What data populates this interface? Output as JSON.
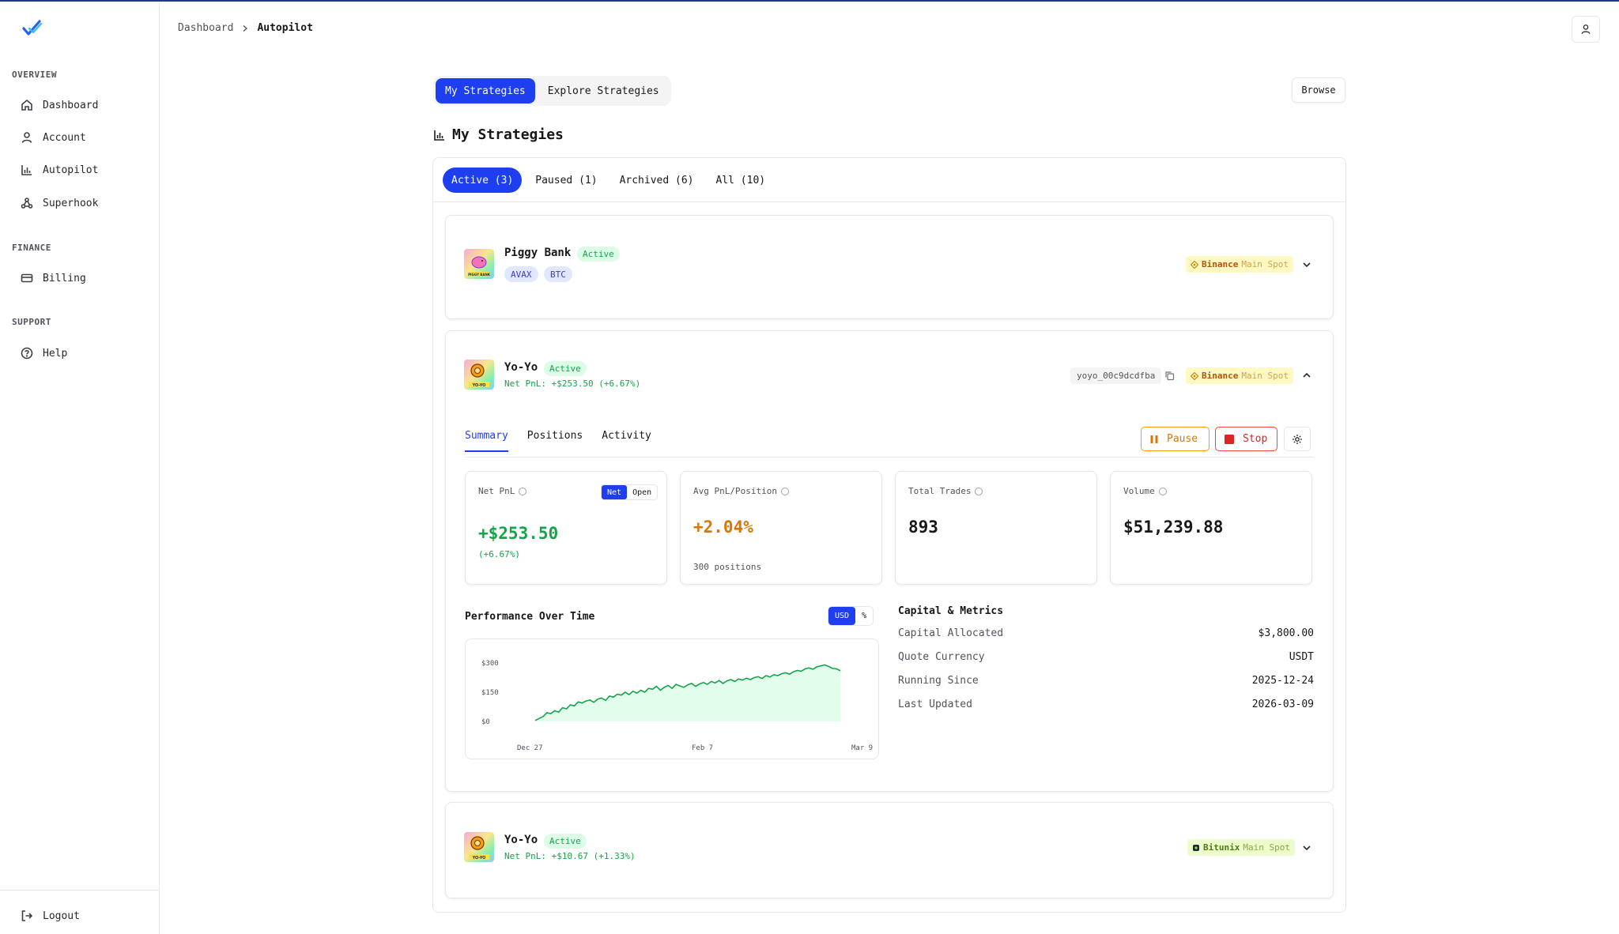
{
  "sidebar": {
    "sections": [
      {
        "label": "OVERVIEW"
      },
      {
        "label": "FINANCE"
      },
      {
        "label": "SUPPORT"
      }
    ],
    "items": [
      {
        "label": "Dashboard",
        "icon": "home-icon"
      },
      {
        "label": "Account",
        "icon": "user-icon"
      },
      {
        "label": "Autopilot",
        "icon": "bar-chart-icon"
      },
      {
        "label": "Superhook",
        "icon": "webhook-icon"
      },
      {
        "label": "Billing",
        "icon": "credit-card-icon"
      },
      {
        "label": "Help",
        "icon": "help-circle-icon"
      }
    ],
    "logout": "Logout"
  },
  "breadcrumb": {
    "parent": "Dashboard",
    "current": "Autopilot"
  },
  "top_tabs": [
    "My Strategies",
    "Explore Strategies"
  ],
  "browse_label": "Browse",
  "page_title": "My Strategies",
  "filter_tabs": [
    "Active (3)",
    "Paused (1)",
    "Archived (6)",
    "All (10)"
  ],
  "strategies": [
    {
      "name": "Piggy Bank",
      "status": "Active",
      "coins": [
        "AVAX",
        "BTC"
      ],
      "exchange": "Binance",
      "market": "Main Spot",
      "icon_caption": "PIGGY BANK"
    },
    {
      "name": "Yo-Yo",
      "status": "Active",
      "pnl": "Net PnL: +$253.50 (+6.67%)",
      "id": "yoyo_00c9dcdfba",
      "exchange": "Binance",
      "market": "Main Spot",
      "icon_caption": "YO-YO"
    },
    {
      "name": "Yo-Yo",
      "status": "Active",
      "pnl": "Net PnL: +$10.67 (+1.33%)",
      "exchange": "Bitunix",
      "market": "Main Spot",
      "icon_caption": "YO-YO"
    }
  ],
  "detail": {
    "tabs": [
      "Summary",
      "Positions",
      "Activity"
    ],
    "pause_label": "Pause",
    "stop_label": "Stop",
    "metrics": {
      "net_pnl": {
        "label": "Net PnL",
        "value": "+$253.50",
        "sub": "(+6.67%)",
        "toggle": [
          "Net",
          "Open"
        ]
      },
      "avg_pnl": {
        "label": "Avg PnL/Position",
        "value": "+2.04%",
        "sub": "300 positions"
      },
      "total_trades": {
        "label": "Total Trades",
        "value": "893"
      },
      "volume": {
        "label": "Volume",
        "value": "$51,239.88"
      }
    },
    "perf_title": "Performance Over Time",
    "unit_toggle": [
      "USD",
      "%"
    ],
    "capital_title": "Capital & Metrics",
    "capital_rows": [
      {
        "key": "Capital Allocated",
        "value": "$3,800.00"
      },
      {
        "key": "Quote Currency",
        "value": "USDT"
      },
      {
        "key": "Running Since",
        "value": "2025-12-24"
      },
      {
        "key": "Last Updated",
        "value": "2026-03-09"
      }
    ]
  },
  "colors": {
    "accent": "#1d3ff0",
    "positive": "#16a34a",
    "warning": "#d97706",
    "danger": "#dc2626"
  },
  "chart_data": {
    "type": "area",
    "x_tick_labels": [
      "Dec 27",
      "Feb 7",
      "Mar 9"
    ],
    "y_tick_labels": [
      "$300",
      "$150",
      "$0"
    ],
    "ylim": [
      0,
      300
    ],
    "series": [
      {
        "values": [
          5,
          15,
          25,
          45,
          40,
          55,
          48,
          70,
          65,
          85,
          80,
          100,
          95,
          105,
          110,
          98,
          115,
          120,
          108,
          130,
          125,
          140,
          135,
          150,
          138,
          155,
          145,
          160,
          150,
          170,
          165,
          180,
          160,
          175,
          185,
          170,
          190,
          182,
          175,
          188,
          195,
          180,
          192,
          200,
          190,
          205,
          198,
          210,
          195,
          208,
          215,
          205,
          218,
          212,
          222,
          215,
          225,
          230,
          220,
          235,
          228,
          240,
          235,
          245,
          250,
          242,
          255,
          262,
          258,
          270,
          275,
          268,
          280,
          285,
          290,
          282,
          272,
          270,
          260
        ]
      }
    ]
  }
}
